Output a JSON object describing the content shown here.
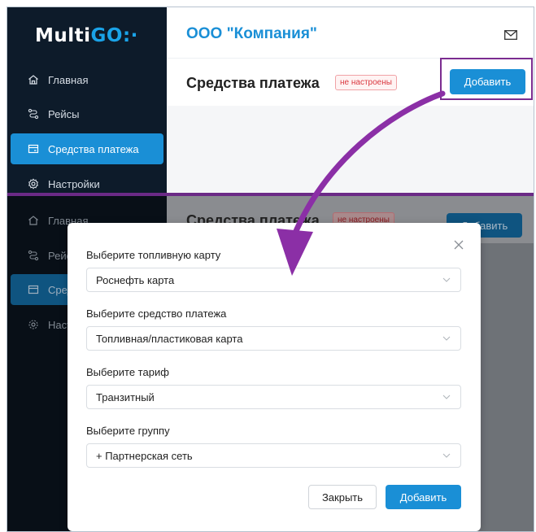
{
  "app": {
    "logo_main": "Multi",
    "logo_accent": "GO",
    "logo_tail": ":·"
  },
  "header": {
    "company": "ООО \"Компания\"",
    "mail_icon": "mail-icon"
  },
  "sidebar": {
    "items": [
      {
        "label": "Главная",
        "icon": "home-icon"
      },
      {
        "label": "Рейсы",
        "icon": "route-icon"
      },
      {
        "label": "Средства платежа",
        "icon": "card-icon",
        "active": true
      },
      {
        "label": "Настройки",
        "icon": "gear-icon"
      }
    ],
    "items_bottom": [
      {
        "label": "Главная"
      },
      {
        "label": "Рейс"
      },
      {
        "label": "Сред"
      },
      {
        "label": "Наст"
      }
    ]
  },
  "page": {
    "title": "Средства платежа",
    "badge": "не настроены",
    "add_button": "Добавить"
  },
  "modal": {
    "fields": [
      {
        "label": "Выберите топливную карту",
        "value": "Роснефть карта"
      },
      {
        "label": "Выберите средство платежа",
        "value": "Топливная/пластиковая карта"
      },
      {
        "label": "Выберите тариф",
        "value": "Транзитный"
      },
      {
        "label": "Выберите группу",
        "value": "+ Партнерская сеть"
      }
    ],
    "close_button": "Закрыть",
    "add_button": "Добавить"
  },
  "colors": {
    "accent": "#1a8fd6",
    "sidebar": "#0d1b2a",
    "annotation": "#7b2c90",
    "badge_red": "#d9363e"
  }
}
